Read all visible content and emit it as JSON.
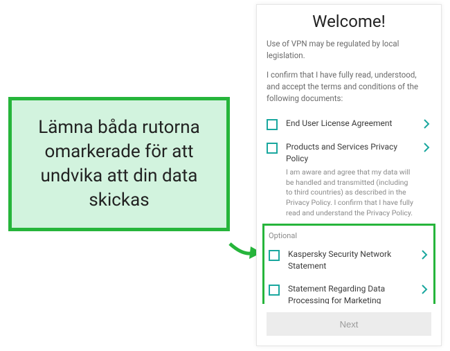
{
  "callout": {
    "text": "Lämna båda rutorna omarkerade för att undvika att din data skickas"
  },
  "colors": {
    "accent_green": "#26b53b",
    "teal": "#19a79e"
  },
  "app": {
    "title": "Welcome!",
    "intro1": "Use of VPN may be regulated by local legislation.",
    "intro2": "I confirm that I have fully read, understood, and accept the terms and conditions of the following documents:",
    "items": [
      {
        "label": "End User License Agreement",
        "subtext": ""
      },
      {
        "label": "Products and Services Privacy Policy",
        "subtext": "I am aware and agree that my data will be handled and transmitted (including to third countries) as described in the Privacy Policy. I confirm that I have fully read and understand the Privacy Policy."
      }
    ],
    "optional_header": "Optional",
    "optional_items": [
      {
        "label": "Kaspersky Security Network Statement"
      },
      {
        "label": "Statement Regarding Data Processing for Marketing Purposes"
      }
    ],
    "next_label": "Next"
  }
}
